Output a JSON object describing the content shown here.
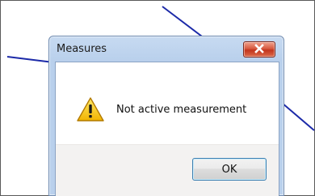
{
  "dialog": {
    "title": "Measures",
    "message": "Not active measurement",
    "ok_label": "OK"
  },
  "icons": {
    "warning": "warning-icon",
    "close": "close-icon"
  },
  "colors": {
    "line": "#1c2aa8",
    "close_button": "#c94a33",
    "ok_border": "#3c7fb1"
  }
}
